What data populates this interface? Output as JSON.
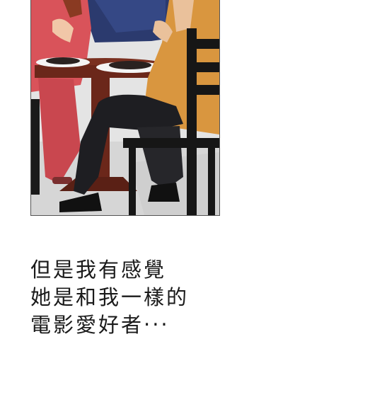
{
  "caption": {
    "lines": [
      "但是我有感覺",
      "她是和我一樣的",
      "電影愛好者‧‧‧"
    ]
  },
  "illustration": {
    "subject": "dinner-scene",
    "colors": {
      "window_night": "#2b3a6e",
      "wall": "#e6e6e6",
      "floor": "#d9d9d9",
      "table_wood": "#7a3020",
      "dress": "#d9535a",
      "jacket": "#d9963f",
      "pants": "#1e1e22",
      "chair": "#161616"
    }
  }
}
